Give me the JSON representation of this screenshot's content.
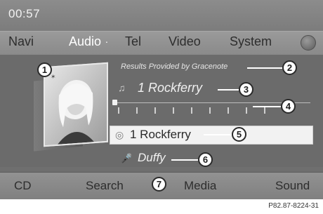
{
  "status": {
    "clock": "00:57"
  },
  "main_menu": {
    "items": [
      {
        "label": "Navi",
        "active": false
      },
      {
        "label": "Audio",
        "active": true
      },
      {
        "label": "Tel",
        "active": false
      },
      {
        "label": "Video",
        "active": false
      },
      {
        "label": "System",
        "active": false
      }
    ],
    "active_marker": "."
  },
  "content": {
    "gracenote": "Results Provided by Gracenote",
    "track_title": "1 Rockferry",
    "album": "1 Rockferry",
    "artist": "Duffy",
    "progress_fraction": 0.0,
    "icons": {
      "track": "music-note-icon",
      "album": "disc-icon",
      "artist": "microphone-icon"
    }
  },
  "bottom_menu": {
    "items": [
      "CD",
      "Search",
      "Media",
      "Sound"
    ]
  },
  "callouts": [
    "1",
    "2",
    "3",
    "4",
    "5",
    "6",
    "7"
  ],
  "figure_code": "P82.87-8224-31",
  "colors": {
    "screen_bg": "#6f6f6f",
    "selected_row": "#f2f2f2",
    "text_light": "#f0f0f0",
    "text_dark": "#2d2d2d"
  }
}
